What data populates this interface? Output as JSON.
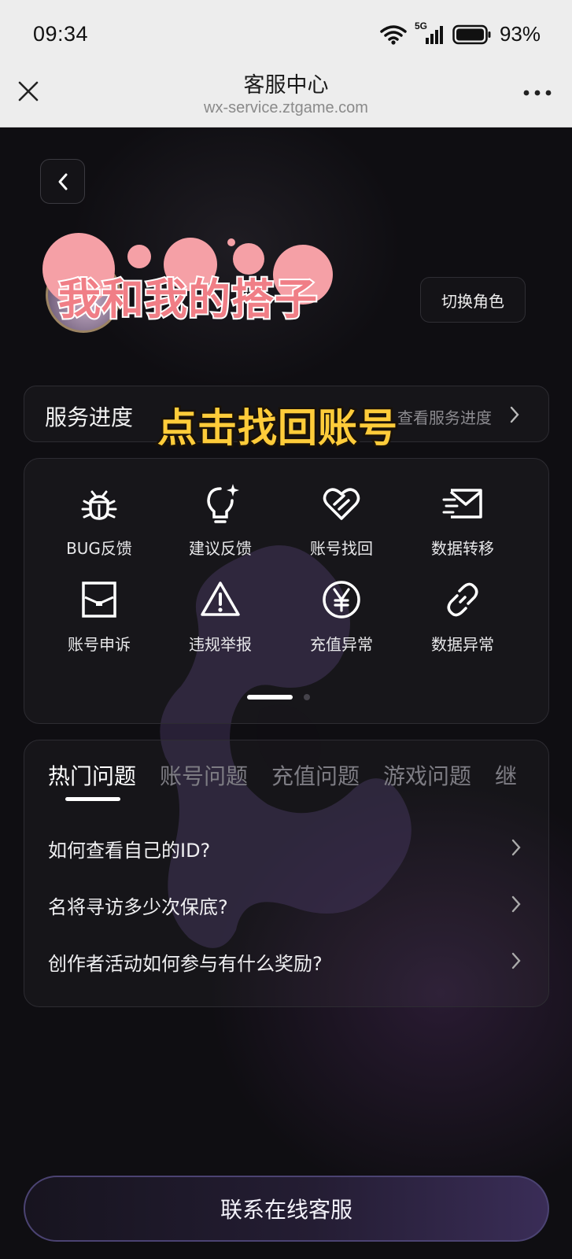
{
  "status_bar": {
    "time": "09:34",
    "network": "5G",
    "battery": "93%"
  },
  "nav": {
    "title": "客服中心",
    "url": "wx-service.ztgame.com"
  },
  "profile": {
    "overlay_name": "我和我的搭子",
    "switch_role_label": "切换角色"
  },
  "service_progress": {
    "label": "服务进度",
    "link": "查看服务进度"
  },
  "overlay_instruction": "点击找回账号",
  "grid_items": [
    {
      "label": "BUG反馈",
      "icon": "bug-icon"
    },
    {
      "label": "建议反馈",
      "icon": "lightbulb-icon"
    },
    {
      "label": "账号找回",
      "icon": "heart-link-icon"
    },
    {
      "label": "数据转移",
      "icon": "mail-transfer-icon"
    },
    {
      "label": "账号申诉",
      "icon": "envelope-icon"
    },
    {
      "label": "违规举报",
      "icon": "warning-icon"
    },
    {
      "label": "充值异常",
      "icon": "yen-icon"
    },
    {
      "label": "数据异常",
      "icon": "link-icon"
    }
  ],
  "faq": {
    "tabs": [
      "热门问题",
      "账号问题",
      "充值问题",
      "游戏问题",
      "继"
    ],
    "active_tab": "热门问题",
    "questions": [
      "如何查看自己的ID?",
      "名将寻访多少次保底?",
      "创作者活动如何参与有什么奖励?"
    ]
  },
  "cta_label": "联系在线客服",
  "colors": {
    "accent_overlay_pink": "#f07e86",
    "accent_overlay_yellow": "#ffcc3a",
    "cta_border": "#4b4372"
  }
}
